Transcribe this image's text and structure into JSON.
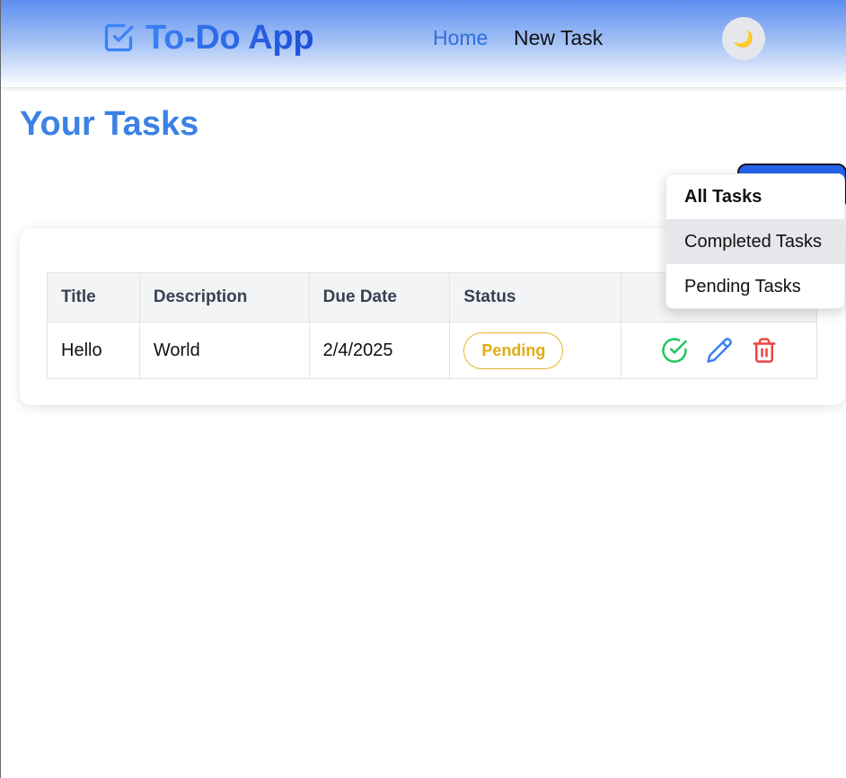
{
  "header": {
    "brand_title": "To-Do App",
    "brand_icon": "checkbox-icon",
    "nav": [
      {
        "label": "Home",
        "active": true
      },
      {
        "label": "New Task",
        "active": false
      }
    ],
    "theme_toggle_icon": "🌙"
  },
  "main": {
    "title": "Your Tasks",
    "filter_menu": {
      "items": [
        {
          "label": "All Tasks",
          "selected": true
        },
        {
          "label": "Completed Tasks",
          "hovered": true
        },
        {
          "label": "Pending Tasks"
        }
      ]
    },
    "table": {
      "columns": [
        "Title",
        "Description",
        "Due Date",
        "Status",
        ""
      ],
      "rows": [
        {
          "title": "Hello",
          "description": "World",
          "due_date": "2/4/2025",
          "status": "Pending",
          "actions": [
            "check-circle-icon",
            "pencil-icon",
            "trash-icon"
          ]
        }
      ]
    }
  },
  "colors": {
    "accent": "#3b82f6",
    "pending": "#eab308",
    "complete": "#22c55e",
    "delete": "#ef4444"
  }
}
